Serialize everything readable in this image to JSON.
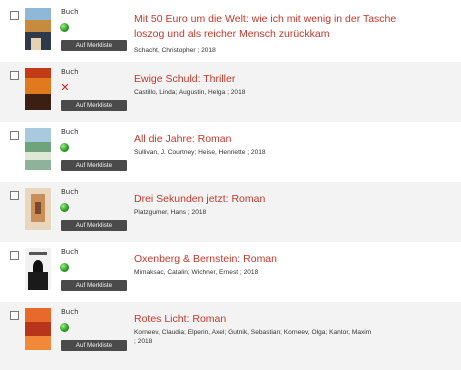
{
  "results": [
    {
      "media_type": "Buch",
      "available": true,
      "memo_label": "Auf Merkliste",
      "title_line1": "Mit 50 Euro um die Welt: wie ich mit wenig in der Tasche",
      "title_line2": "loszog und als reicher Mensch zurückkam",
      "author": "Schacht, Christopher ; 2018"
    },
    {
      "media_type": "Buch",
      "available": false,
      "memo_label": "Auf Merkliste",
      "title_line1": "Ewige Schuld: Thriller",
      "author": "Castillo, Linda; Augustin, Helga ; 2018"
    },
    {
      "media_type": "Buch",
      "available": true,
      "memo_label": "Auf Merkliste",
      "title_line1": "All die Jahre: Roman",
      "author": "Sullivan, J. Courtney; Heise, Henriette ; 2018"
    },
    {
      "media_type": "Buch",
      "available": true,
      "memo_label": "Auf Merkliste",
      "title_line1": "Drei Sekunden jetzt: Roman",
      "author": "Platzgumer, Hans ; 2018"
    },
    {
      "media_type": "Buch",
      "available": true,
      "memo_label": "Auf Merkliste",
      "title_line1": "Oxenberg & Bernstein: Roman",
      "author": "Mimaksac, Catalin; Wichner, Ernest ; 2018"
    },
    {
      "media_type": "Buch",
      "available": true,
      "memo_label": "Auf Merkliste",
      "title_line1": "Rotes Licht: Roman",
      "author": "Korneev, Claudia; Elperin, Axel; Gutnik, Sebastian; Korneev, Olga; Kantor, Maxim",
      "author_line2": "; 2018"
    }
  ]
}
